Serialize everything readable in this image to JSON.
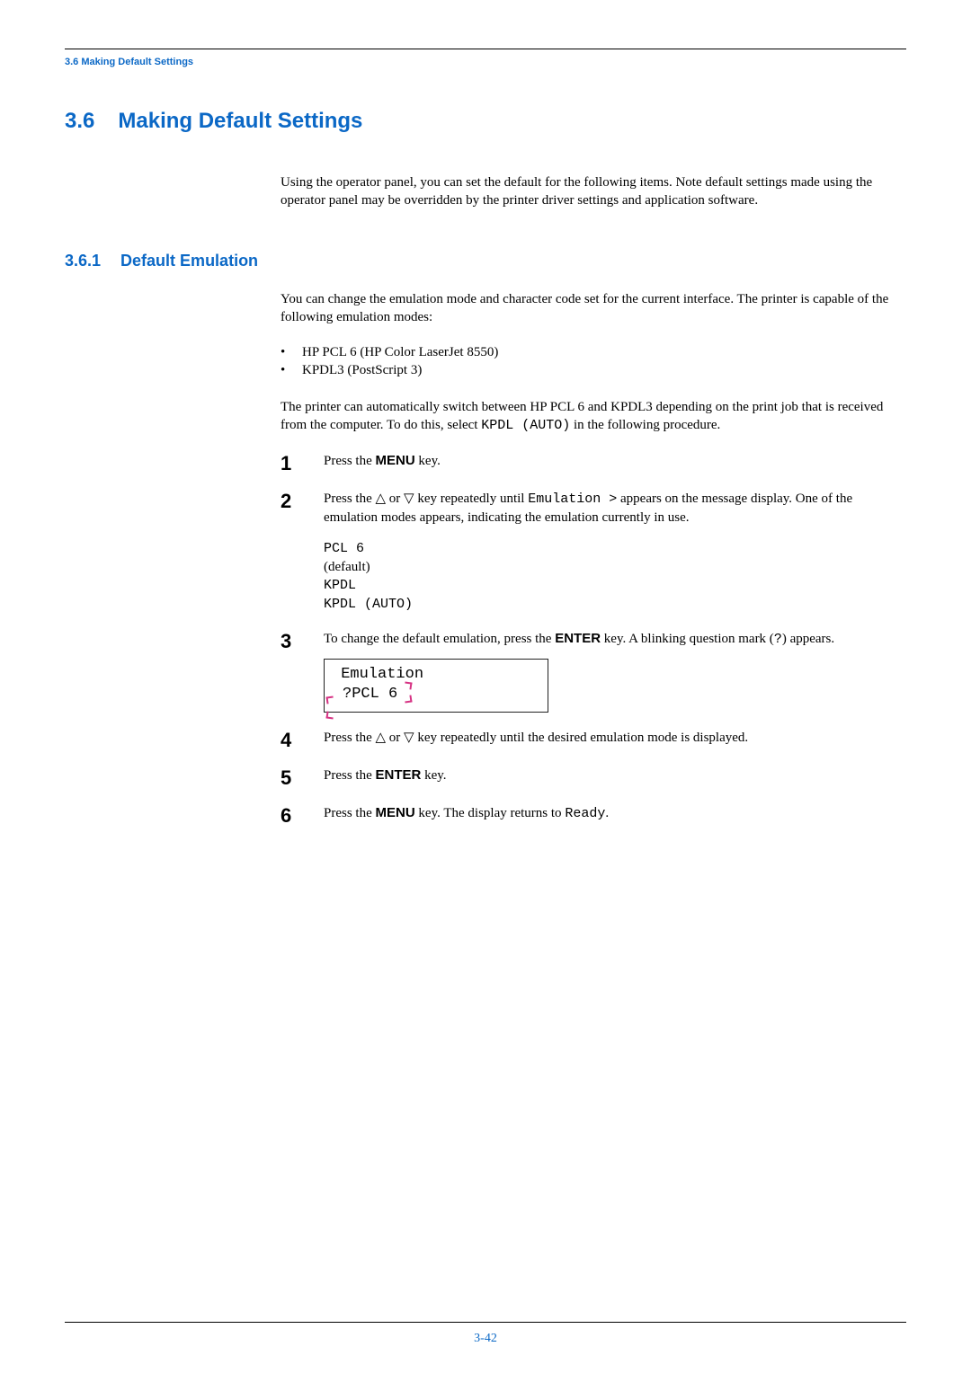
{
  "running_header": "3.6 Making Default Settings",
  "h1": {
    "num": "3.6",
    "title": "Making Default Settings"
  },
  "intro": "Using the operator panel, you can set the default for the following items. Note default settings made using the operator panel may be overridden by the printer driver settings and application software.",
  "h2": {
    "num": "3.6.1",
    "title": "Default Emulation"
  },
  "p1": "You can change the emulation mode and character code set for the current interface. The printer is capable of the following emulation modes:",
  "bullets": [
    "HP PCL 6 (HP Color LaserJet 8550)",
    "KPDL3 (PostScript 3)"
  ],
  "p2_a": "The printer can automatically switch between HP PCL 6 and KPDL3 depending on the print job that is received from the computer. To do this, select ",
  "p2_code": "KPDL (AUTO)",
  "p2_b": " in the following procedure.",
  "steps": {
    "1": {
      "a": "Press the ",
      "key": "MENU",
      "b": " key."
    },
    "2": {
      "a": "Press the ",
      "up": "△",
      "mid": " or ",
      "down": "▽",
      "b": " key repeatedly until ",
      "code": "Emulation >",
      "c": " appears on the message display. One of the emulation modes appears, indicating the emulation currently in use.",
      "list1_a": "PCL 6",
      "list1_b": " (default)",
      "list2": "KPDL",
      "list3": "KPDL (AUTO)"
    },
    "3": {
      "a": "To change the default emulation, press the ",
      "key": "ENTER",
      "b": " key. A blinking question mark (",
      "code": "?",
      "c": ") appears.",
      "disp_l1": "Emulation",
      "disp_l2": "?PCL 6"
    },
    "4": {
      "a": "Press the ",
      "up": "△",
      "mid": " or ",
      "down": "▽",
      "b": " key repeatedly until the desired emulation mode is displayed."
    },
    "5": {
      "a": "Press the ",
      "key": "ENTER",
      "b": " key."
    },
    "6": {
      "a": "Press the ",
      "key": "MENU",
      "b": " key. The display returns to ",
      "code": "Ready",
      "c": "."
    }
  },
  "page_num": "3-42"
}
